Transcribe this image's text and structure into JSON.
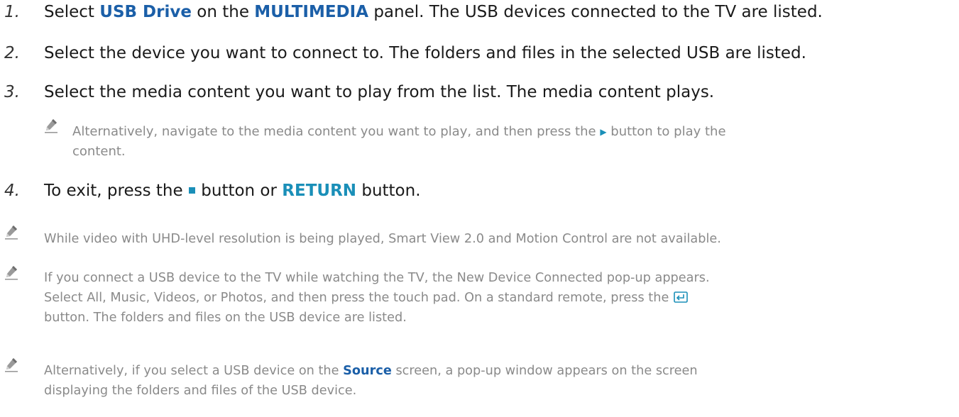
{
  "colors": {
    "highlight": "#1b5fa8",
    "accent": "#1a8fb8",
    "note_text": "#8a8a8a",
    "body_text": "#1a1a1a"
  },
  "icons": {
    "note": "pencil-note-icon",
    "play": "play-button-icon",
    "stop": "stop-button-icon",
    "enter": "enter-button-icon"
  },
  "steps": [
    {
      "num": "1.",
      "a": "Select ",
      "b": "USB Drive",
      "c": " on the ",
      "d": "MULTIMEDIA",
      "e": " panel. The USB devices connected to the TV are listed."
    },
    {
      "num": "2.",
      "text": "Select the device you want to connect to. The folders and files in the selected USB are listed."
    },
    {
      "num": "3.",
      "text": "Select the media content you want to play from the list. The media content plays."
    },
    {
      "num": "4.",
      "a": "To exit, press the ",
      "b": " button or ",
      "c": "RETURN",
      "d": " button."
    }
  ],
  "step3_note": {
    "a": "Alternatively, navigate to the media content you want to play, and then press the ",
    "b": " button to play the",
    "c": "content."
  },
  "notes": [
    {
      "line1": "While video with UHD-level resolution is being played, Smart View 2.0 and Motion Control are not available."
    },
    {
      "line1": "If you connect a USB device to the TV while watching the TV, the New Device Connected pop-up appears.",
      "line2": "Select All, Music, Videos, or Photos, and then press the touch pad. On a standard remote, press the ",
      "line3": "button. The folders and files on the USB device are listed."
    },
    {
      "a": "Alternatively, if you select a USB device on the ",
      "b": "Source",
      "c": " screen, a pop-up window appears on the screen",
      "line2": "displaying the folders and files of the USB device."
    }
  ]
}
